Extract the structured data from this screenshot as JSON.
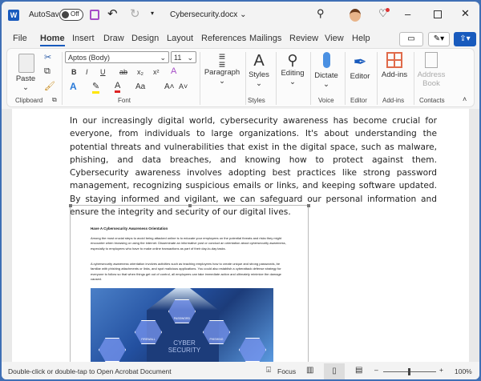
{
  "titlebar": {
    "autosave_label": "AutoSave",
    "autosave_state": "Off",
    "filename": "Cybersecurity.docx ⌄"
  },
  "tabs": [
    "File",
    "Home",
    "Insert",
    "Draw",
    "Design",
    "Layout",
    "References",
    "Mailings",
    "Review",
    "View",
    "Help"
  ],
  "active_tab": "Home",
  "ribbon": {
    "clipboard": {
      "paste": "Paste",
      "label": "Clipboard"
    },
    "font": {
      "name": "Aptos (Body)",
      "size": "11",
      "label": "Font",
      "bold": "B",
      "italic": "I",
      "underline": "U",
      "strike": "ab",
      "sub": "x₂",
      "sup": "x²",
      "case": "Aa",
      "grow": "A˄",
      "shrink": "A˅"
    },
    "paragraph": {
      "label": "Paragraph"
    },
    "styles": {
      "button": "Styles",
      "label": "Styles"
    },
    "editing": {
      "button": "Editing"
    },
    "voice": {
      "button": "Dictate",
      "label": "Voice"
    },
    "editor": {
      "button": "Editor",
      "label": "Editor"
    },
    "addins": {
      "button": "Add-ins",
      "label": "Add-ins"
    },
    "contacts": {
      "button": "Address Book",
      "label": "Contacts"
    }
  },
  "document": {
    "paragraph": "In our increasingly digital world, cybersecurity awareness has become crucial for everyone, from individuals to large organizations. It's about understanding the potential threats and vulnerabilities that exist in the digital space, such as malware, phishing, and data breaches, and knowing how to protect against them. Cybersecurity awareness involves adopting best practices like strong password management, recognizing suspicious emails or links, and keeping software updated. By staying informed and vigilant, we can safeguard our personal information and ensure the integrity and security of our digital lives.",
    "embedded": {
      "heading": "Have A Cybersecurity Awareness Orientation",
      "p1": "Among the most crucial steps to avoid being attacked online is to educate your employees on the potential threats and risks they might encounter when browsing or using the internet. Disseminate an informative post or conduct an orientation about cybersecurity awareness, especially to employees who have to make online transactions as part of their day-to-day tasks.",
      "p2": "A cybersecurity awareness orientation involves activities such as teaching employees how to create unique and strong passwords, be familiar with phishing attachments or links, and spot malicious applications. You could also establish a cyberattack defense strategy for everyone to follow so that when things get out of control, all employees can take immediate action and ultimately minimize the damage caused.",
      "image_text": "CYBER SECURITY",
      "hex_labels": [
        "FIREWALL",
        "PASSWORD",
        "PHISHING"
      ]
    }
  },
  "statusbar": {
    "message": "Double-click or double-tap to Open Acrobat Document",
    "focus": "Focus",
    "zoom": "100%",
    "zoom_level": 100
  },
  "colors": {
    "accent": "#185abd",
    "window_border": "#3f6fb5",
    "save": "#a64cc7"
  }
}
